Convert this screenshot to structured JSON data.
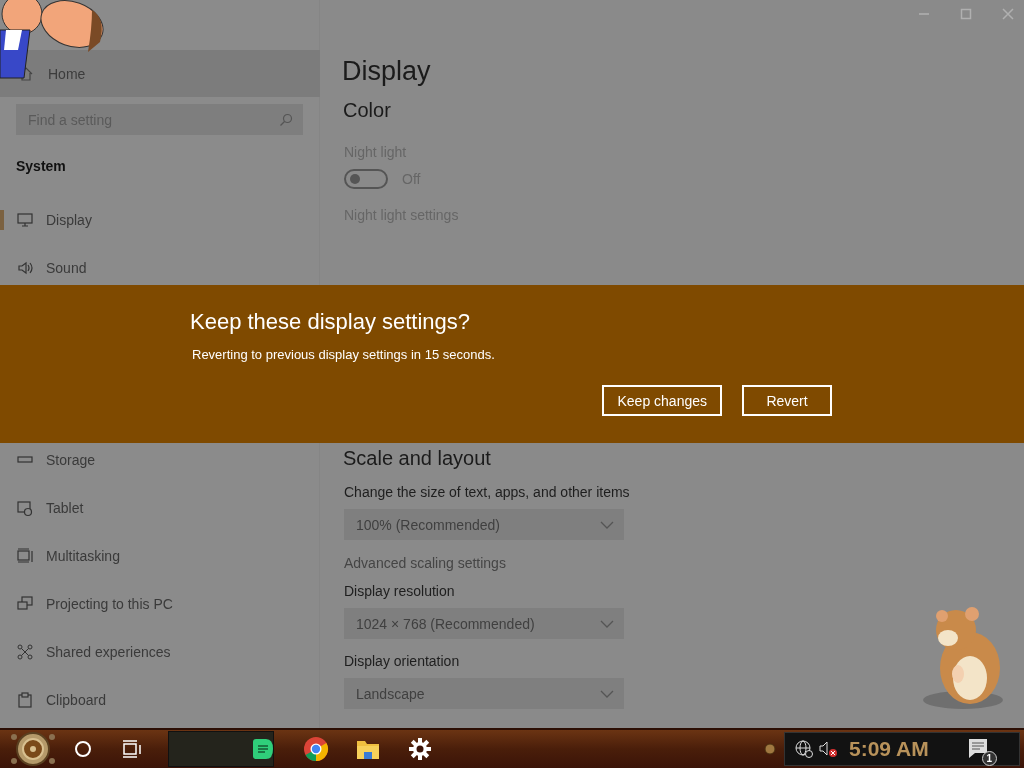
{
  "sidebar": {
    "home": {
      "label": "Home"
    },
    "search": {
      "placeholder": "Find a setting"
    },
    "section": "System",
    "items": [
      {
        "label": "Display",
        "selected": true
      },
      {
        "label": "Sound",
        "selected": false
      },
      {
        "label": "Storage",
        "selected": false
      },
      {
        "label": "Tablet",
        "selected": false
      },
      {
        "label": "Multitasking",
        "selected": false
      },
      {
        "label": "Projecting to this PC",
        "selected": false
      },
      {
        "label": "Shared experiences",
        "selected": false
      },
      {
        "label": "Clipboard",
        "selected": false
      }
    ]
  },
  "content": {
    "title": "Display",
    "color_heading": "Color",
    "night_light": {
      "label": "Night light",
      "on": false,
      "state_text": "Off",
      "link": "Night light settings"
    },
    "scale_heading": "Scale and layout",
    "scale_items": [
      {
        "kind": "dropdown",
        "label": "Change the size of text, apps, and other items",
        "value": "100% (Recommended)"
      },
      {
        "kind": "link",
        "label": "Advanced scaling settings"
      },
      {
        "kind": "dropdown",
        "label": "Display resolution",
        "value": "1024 × 768 (Recommended)"
      },
      {
        "kind": "dropdown",
        "label": "Display orientation",
        "value": "Landscape"
      }
    ]
  },
  "dialog": {
    "title": "Keep these display settings?",
    "message": "Reverting to previous display settings in 15 seconds.",
    "buttons": [
      "Keep changes",
      "Revert"
    ]
  },
  "taskbar": {
    "clock": "5:09 AM",
    "notification_count": "1"
  }
}
